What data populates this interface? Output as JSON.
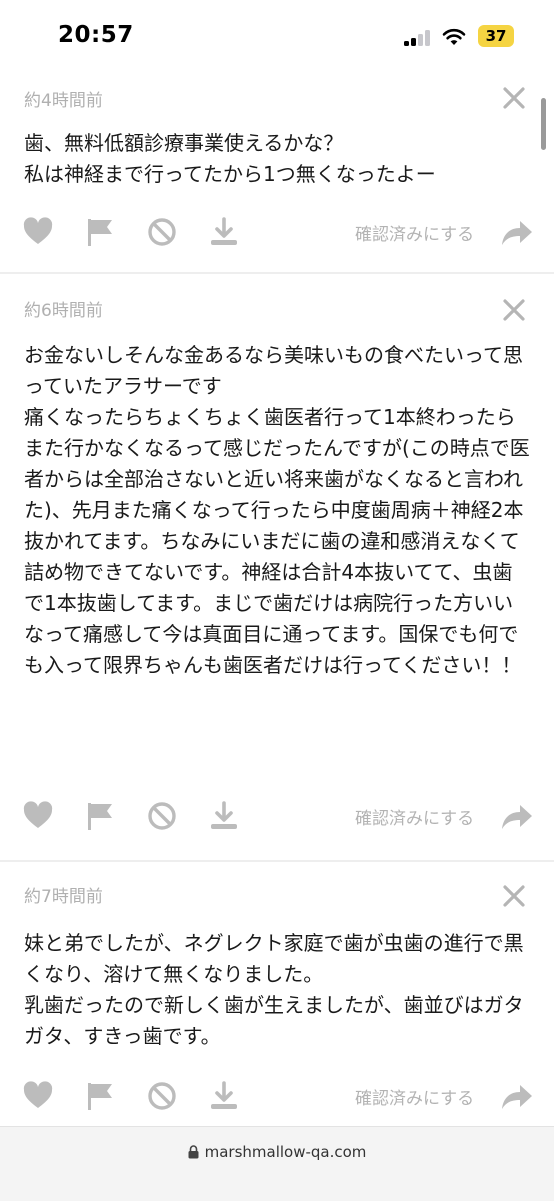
{
  "status": {
    "time": "20:57",
    "battery": "37"
  },
  "cards": [
    {
      "time": "約4時間前",
      "body": "歯、無料低額診療事業使えるかな？\n私は神経まで行ってたから1つ無くなったよー",
      "confirm_label": "確認済みにする"
    },
    {
      "time": "約6時間前",
      "body": "お金ないしそんな金あるなら美味いもの食べたいって思っていたアラサーです\n痛くなったらちょくちょく歯医者行って1本終わったらまた行かなくなるって感じだったんですが(この時点で医者からは全部治さないと近い将来歯がなくなると言われた)、先月また痛くなって行ったら中度歯周病＋神経2本抜かれてます。ちなみにいまだに歯の違和感消えなくて詰め物できてないです。神経は合計4本抜いてて、虫歯で1本抜歯してます。まじで歯だけは病院行った方いいなって痛感して今は真面目に通ってます。国保でも何でも入って限界ちゃんも歯医者だけは行ってください！！",
      "confirm_label": "確認済みにする"
    },
    {
      "time": "約7時間前",
      "body": "妹と弟でしたが、ネグレクト家庭で歯が虫歯の進行で黒くなり、溶けて無くなりました。\n乳歯だったので新しく歯が生えましたが、歯並びはガタガタ、すきっ歯です。",
      "confirm_label": "確認済みにする"
    }
  ],
  "browser": {
    "url": "marshmallow-qa.com"
  }
}
